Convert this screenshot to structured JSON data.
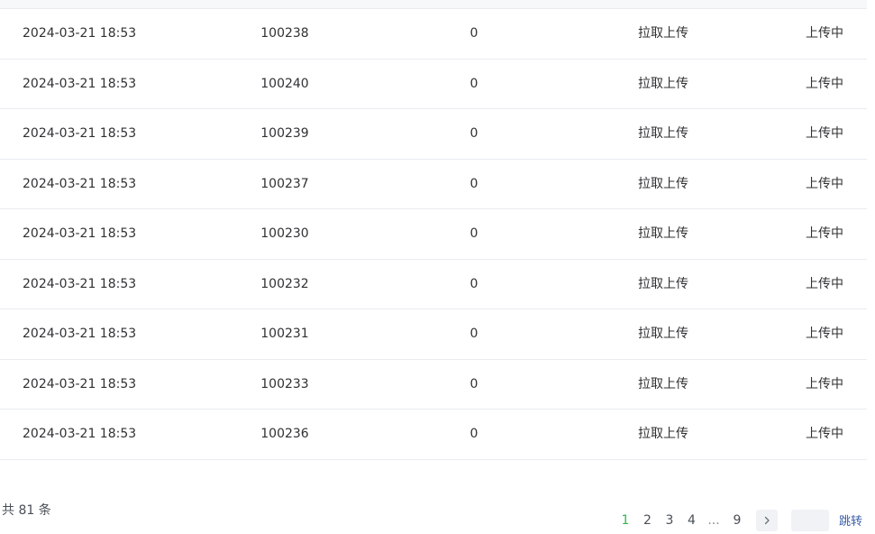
{
  "table": {
    "rows": [
      {
        "time": "2024-03-21 18:53",
        "id": "100238",
        "count": "0",
        "type": "拉取上传",
        "status": "上传中"
      },
      {
        "time": "2024-03-21 18:53",
        "id": "100240",
        "count": "0",
        "type": "拉取上传",
        "status": "上传中"
      },
      {
        "time": "2024-03-21 18:53",
        "id": "100239",
        "count": "0",
        "type": "拉取上传",
        "status": "上传中"
      },
      {
        "time": "2024-03-21 18:53",
        "id": "100237",
        "count": "0",
        "type": "拉取上传",
        "status": "上传中"
      },
      {
        "time": "2024-03-21 18:53",
        "id": "100230",
        "count": "0",
        "type": "拉取上传",
        "status": "上传中"
      },
      {
        "time": "2024-03-21 18:53",
        "id": "100232",
        "count": "0",
        "type": "拉取上传",
        "status": "上传中"
      },
      {
        "time": "2024-03-21 18:53",
        "id": "100231",
        "count": "0",
        "type": "拉取上传",
        "status": "上传中"
      },
      {
        "time": "2024-03-21 18:53",
        "id": "100233",
        "count": "0",
        "type": "拉取上传",
        "status": "上传中"
      },
      {
        "time": "2024-03-21 18:53",
        "id": "100236",
        "count": "0",
        "type": "拉取上传",
        "status": "上传中"
      }
    ]
  },
  "pagination": {
    "total_text": "共 81 条",
    "pages": [
      "1",
      "2",
      "3",
      "4"
    ],
    "ellipsis": "...",
    "last_page": "9",
    "current_page": "1",
    "next_icon": "chevron-right-icon",
    "jump_value": "",
    "jump_label": "跳转"
  },
  "colors": {
    "active_page": "#2db84d",
    "jump_link": "#3a5ca8",
    "row_border": "#e9ebef"
  }
}
